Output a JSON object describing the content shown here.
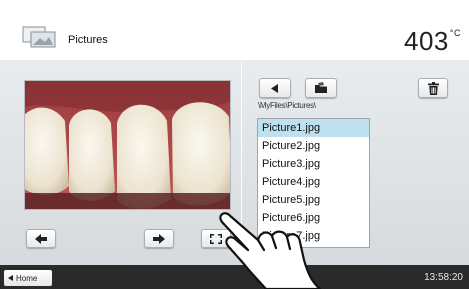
{
  "header": {
    "title": "Pictures",
    "temperature": "403",
    "temperature_unit": "°C",
    "icon": "pictures-icon"
  },
  "viewer": {
    "image": "dental-photo-teeth",
    "prev_icon": "arrow-left-icon",
    "next_icon": "arrow-right-icon",
    "fullscreen_icon": "fullscreen-icon"
  },
  "browser": {
    "back_icon": "triangle-left-icon",
    "open_folder_icon": "folder-open-icon",
    "delete_icon": "trash-icon",
    "path": "\\MyFiles\\Pictures\\",
    "files": [
      {
        "name": "Picture1.jpg",
        "selected": true
      },
      {
        "name": "Picture2.jpg",
        "selected": false
      },
      {
        "name": "Picture3.jpg",
        "selected": false
      },
      {
        "name": "Picture4.jpg",
        "selected": false
      },
      {
        "name": "Picture5.jpg",
        "selected": false
      },
      {
        "name": "Picture6.jpg",
        "selected": false
      },
      {
        "name": "Picture7.jpg",
        "selected": false
      }
    ]
  },
  "footer": {
    "home_label": "Home",
    "time": "13:58:20"
  },
  "colors": {
    "selection": "#bfe1ef",
    "bar": "#2a2a2a",
    "panel": "#e0e3e6"
  }
}
